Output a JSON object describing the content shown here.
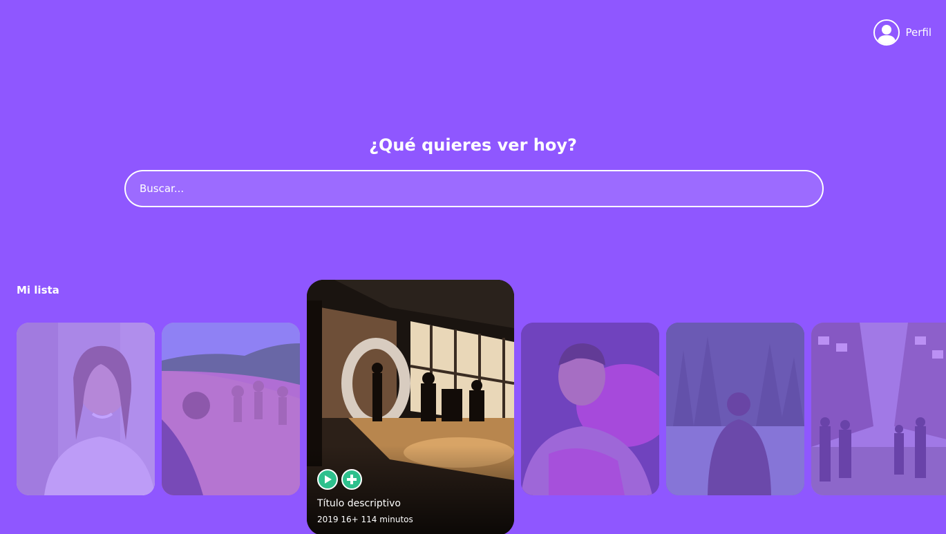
{
  "header": {
    "profile_label": "Perfil",
    "profile_icon": "user-avatar-icon"
  },
  "hero": {
    "title": "¿Qué quieres ver hoy?"
  },
  "search": {
    "placeholder": "Buscar..."
  },
  "list": {
    "title": "Mi lista",
    "featured": {
      "title": "Título descriptivo",
      "meta": "2019 16+ 114 minutos",
      "play_icon": "play-icon",
      "add_icon": "plus-icon"
    }
  },
  "colors": {
    "background": "#8f57ff",
    "accent": "#2ec08d",
    "text": "#ffffff"
  }
}
